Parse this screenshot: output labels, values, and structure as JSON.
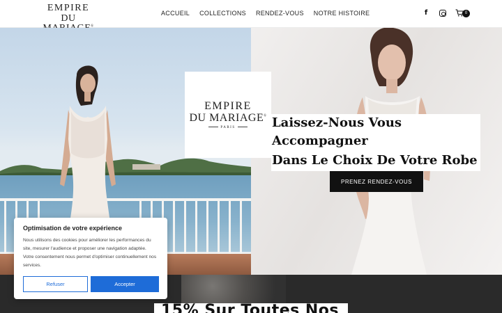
{
  "brand": {
    "line1": "EMPIRE",
    "line2": "DU MARIAGE",
    "mark": "®",
    "line3": "PARIS"
  },
  "nav": {
    "items": [
      {
        "label": "ACCUEIL"
      },
      {
        "label": "COLLECTIONS"
      },
      {
        "label": "RENDEZ-VOUS"
      },
      {
        "label": "NOTRE HISTOIRE"
      }
    ]
  },
  "header_icons": {
    "facebook": "f",
    "cart_count": "0"
  },
  "hero": {
    "headline_line1": "Laissez-Nous Vous Accompagner",
    "headline_line2": "Dans Le Choix De Votre Robe",
    "cta_label": "PRENEZ RENDEZ-VOUS"
  },
  "promo": {
    "text": "15% Sur Toutes Nos"
  },
  "cookie": {
    "title": "Optimisation de votre expérience",
    "body": "Nous utilisons des cookies pour améliorer les performances du site, mesurer l'audience et proposer une navigation adaptée. Votre consentement nous permet d'optimiser continuellement nos services.",
    "refuse_label": "Refuser",
    "accept_label": "Accepter"
  },
  "colors": {
    "accent": "#1e6cd8",
    "dark": "#111111"
  }
}
